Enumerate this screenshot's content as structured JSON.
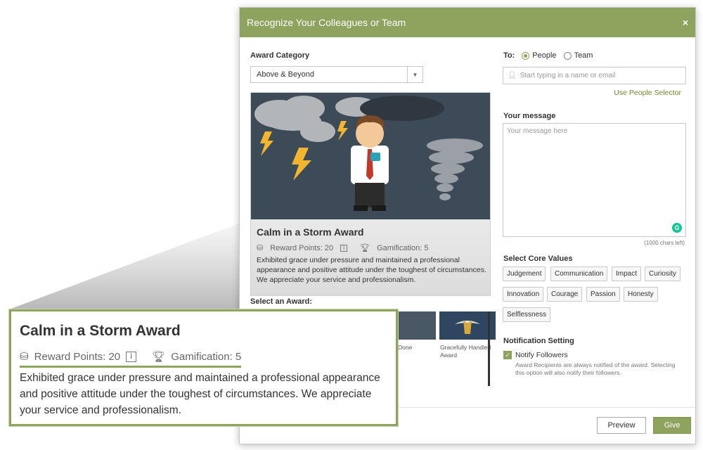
{
  "modal": {
    "title": "Recognize Your Colleagues or Team",
    "close_icon": "close-icon"
  },
  "left": {
    "award_category_label": "Award Category",
    "award_category_value": "Above & Beyond",
    "award": {
      "title": "Calm in a Storm Award",
      "reward_points": "Reward Points: 20",
      "info": "i",
      "gamification": "Gamification: 5",
      "description": "Exhibited grace under pressure and maintained a professional appearance and positive attitude under the toughest of circumstances. We appreciate your service and professionalism."
    },
    "select_award_label": "Select an Award:",
    "thumbs": [
      {
        "label": "Done"
      },
      {
        "label": "Gracefully Handled Award"
      }
    ]
  },
  "right": {
    "to_label": "To:",
    "people_label": "People",
    "team_label": "Team",
    "people_placeholder": "Start typing in a name or email",
    "people_selector_link": "Use People Selector",
    "message_label": "Your message",
    "message_placeholder": "Your message here",
    "grammarly_letter": "G",
    "chars_left": "(1000 chars left)",
    "core_values_label": "Select Core Values",
    "core_values": [
      "Judgement",
      "Communication",
      "Impact",
      "Curiosity",
      "Innovation",
      "Courage",
      "Passion",
      "Honesty",
      "Selflessness"
    ],
    "notification_label": "Notification Setting",
    "notify_label": "Notify Followers",
    "notify_note": "Award Recipients are always notified of the award. Selecting this option will also notify their followers."
  },
  "footer": {
    "preview_label": "Preview",
    "give_label": "Give"
  },
  "colors": {
    "accent": "#8ea35e",
    "link": "#6d8a2c"
  }
}
